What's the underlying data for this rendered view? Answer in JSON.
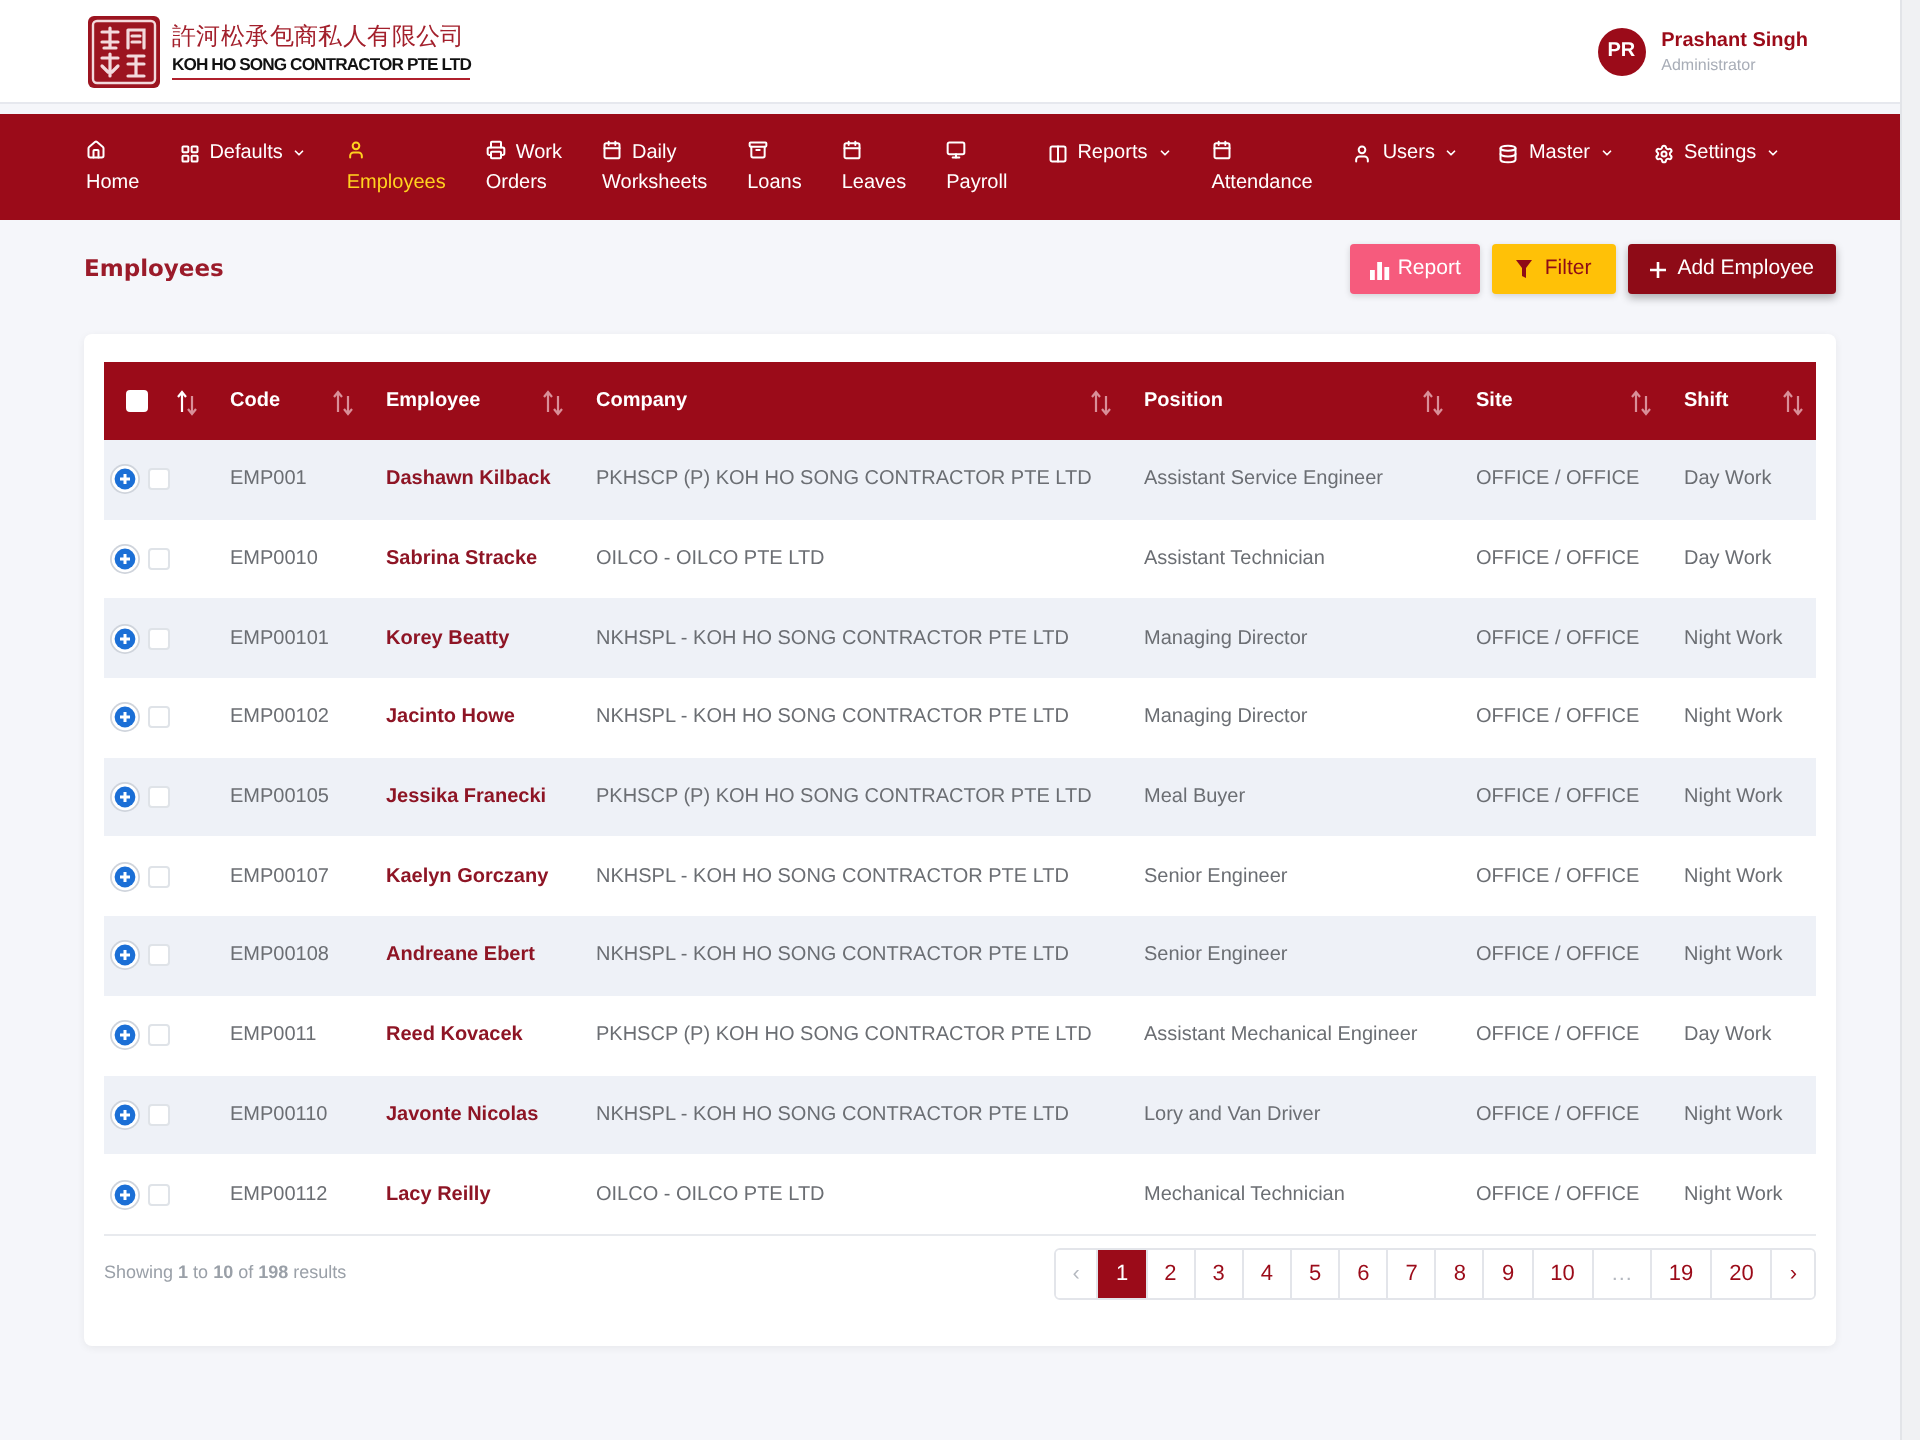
{
  "header": {
    "logo": {
      "chinese_name": "許河松承包商私人有限公司",
      "english_name": "KOH HO SONG CONTRACTOR PTE LTD"
    },
    "user": {
      "initials": "PR",
      "name": "Prashant Singh",
      "role": "Administrator"
    }
  },
  "nav": [
    {
      "label": "Home",
      "kind": "link",
      "selected": false
    },
    {
      "label": "Defaults",
      "kind": "dropdown",
      "selected": false
    },
    {
      "label": "Employees",
      "kind": "link",
      "selected": true
    },
    {
      "label": "Work Orders",
      "kind": "link",
      "selected": false
    },
    {
      "label": "Daily Worksheets",
      "kind": "link",
      "selected": false
    },
    {
      "label": "Loans",
      "kind": "link",
      "selected": false
    },
    {
      "label": "Leaves",
      "kind": "link",
      "selected": false
    },
    {
      "label": "Payroll",
      "kind": "link",
      "selected": false
    },
    {
      "label": "Reports",
      "kind": "dropdown",
      "selected": false
    },
    {
      "label": "Attendance",
      "kind": "link",
      "selected": false
    },
    {
      "label": "Users",
      "kind": "dropdown",
      "selected": false
    },
    {
      "label": "Master",
      "kind": "dropdown",
      "selected": false
    },
    {
      "label": "Settings",
      "kind": "dropdown",
      "selected": false
    }
  ],
  "page": {
    "title": "Employees",
    "actions": [
      {
        "label": "Report",
        "kind": "report"
      },
      {
        "label": "Filter",
        "kind": "filter"
      },
      {
        "label": "Add Employee",
        "kind": "add"
      }
    ]
  },
  "table": {
    "select_column": {
      "checked": false,
      "sorted": true
    },
    "columns": [
      {
        "label": "Code",
        "sorted": false
      },
      {
        "label": "Employee",
        "sorted": false
      },
      {
        "label": "Company",
        "sorted": false
      },
      {
        "label": "Position",
        "sorted": false
      },
      {
        "label": "Site",
        "sorted": false
      },
      {
        "label": "Shift",
        "sorted": false
      }
    ],
    "rows": [
      {
        "expanded": false,
        "checked": false,
        "code": "EMP001",
        "employee": "Dashawn Kilback",
        "company": "PKHSCP (P) KOH HO SONG CONTRACTOR PTE LTD",
        "position": "Assistant Service Engineer",
        "site": "OFFICE / OFFICE",
        "shift": "Day Work"
      },
      {
        "expanded": false,
        "checked": false,
        "code": "EMP0010",
        "employee": "Sabrina Stracke",
        "company": "OILCO - OILCO PTE LTD",
        "position": "Assistant Technician",
        "site": "OFFICE / OFFICE",
        "shift": "Day Work"
      },
      {
        "expanded": false,
        "checked": false,
        "code": "EMP00101",
        "employee": "Korey Beatty",
        "company": "NKHSPL - KOH HO SONG CONTRACTOR PTE LTD",
        "position": "Managing Director",
        "site": "OFFICE / OFFICE",
        "shift": "Night Work"
      },
      {
        "expanded": false,
        "checked": false,
        "code": "EMP00102",
        "employee": "Jacinto Howe",
        "company": "NKHSPL - KOH HO SONG CONTRACTOR PTE LTD",
        "position": "Managing Director",
        "site": "OFFICE / OFFICE",
        "shift": "Night Work"
      },
      {
        "expanded": false,
        "checked": false,
        "code": "EMP00105",
        "employee": "Jessika Franecki",
        "company": "PKHSCP (P) KOH HO SONG CONTRACTOR PTE LTD",
        "position": "Meal Buyer",
        "site": "OFFICE / OFFICE",
        "shift": "Night Work"
      },
      {
        "expanded": false,
        "checked": false,
        "code": "EMP00107",
        "employee": "Kaelyn Gorczany",
        "company": "NKHSPL - KOH HO SONG CONTRACTOR PTE LTD",
        "position": "Senior Engineer",
        "site": "OFFICE / OFFICE",
        "shift": "Night Work"
      },
      {
        "expanded": false,
        "checked": false,
        "code": "EMP00108",
        "employee": "Andreane Ebert",
        "company": "NKHSPL - KOH HO SONG CONTRACTOR PTE LTD",
        "position": "Senior Engineer",
        "site": "OFFICE / OFFICE",
        "shift": "Night Work"
      },
      {
        "expanded": false,
        "checked": false,
        "code": "EMP0011",
        "employee": "Reed Kovacek",
        "company": "PKHSCP (P) KOH HO SONG CONTRACTOR PTE LTD",
        "position": "Assistant Mechanical Engineer",
        "site": "OFFICE / OFFICE",
        "shift": "Day Work"
      },
      {
        "expanded": false,
        "checked": false,
        "code": "EMP00110",
        "employee": "Javonte Nicolas",
        "company": "NKHSPL - KOH HO SONG CONTRACTOR PTE LTD",
        "position": "Lory and Van Driver",
        "site": "OFFICE / OFFICE",
        "shift": "Night Work"
      },
      {
        "expanded": false,
        "checked": false,
        "code": "EMP00112",
        "employee": "Lacy Reilly",
        "company": "OILCO - OILCO PTE LTD",
        "position": "Mechanical Technician",
        "site": "OFFICE / OFFICE",
        "shift": "Night Work"
      }
    ],
    "summary": "Showing **1** to **10** of **198** results",
    "pagination": [
      {
        "label": "‹",
        "selected": false,
        "disabled": true
      },
      {
        "label": "1",
        "selected": true,
        "disabled": false
      },
      {
        "label": "2",
        "selected": false,
        "disabled": false
      },
      {
        "label": "3",
        "selected": false,
        "disabled": false
      },
      {
        "label": "4",
        "selected": false,
        "disabled": false
      },
      {
        "label": "5",
        "selected": false,
        "disabled": false
      },
      {
        "label": "6",
        "selected": false,
        "disabled": false
      },
      {
        "label": "7",
        "selected": false,
        "disabled": false
      },
      {
        "label": "8",
        "selected": false,
        "disabled": false
      },
      {
        "label": "9",
        "selected": false,
        "disabled": false
      },
      {
        "label": "10",
        "selected": false,
        "disabled": false
      },
      {
        "label": "…",
        "selected": false,
        "disabled": true
      },
      {
        "label": "19",
        "selected": false,
        "disabled": false
      },
      {
        "label": "20",
        "selected": false,
        "disabled": false
      },
      {
        "label": "›",
        "selected": false,
        "disabled": false
      }
    ]
  }
}
